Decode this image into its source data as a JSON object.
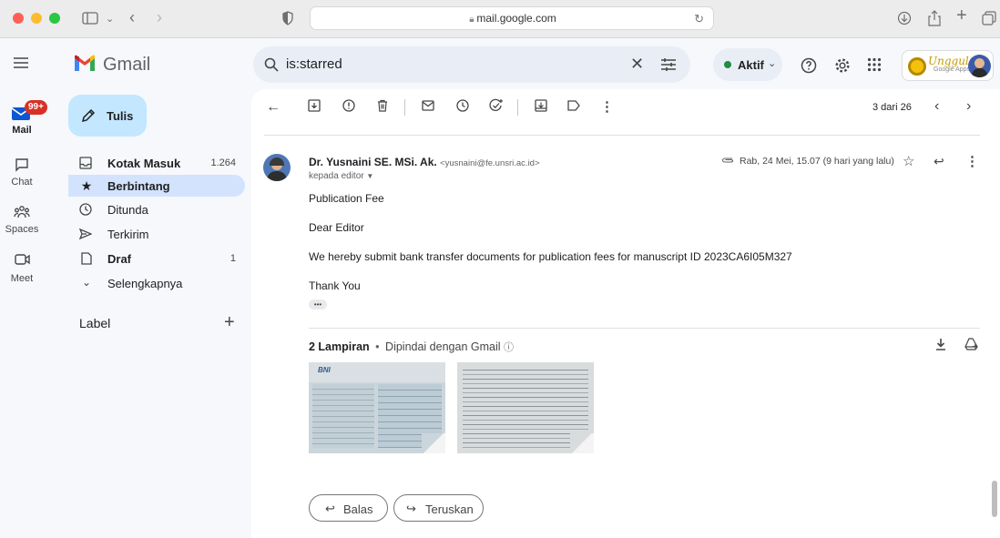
{
  "browser": {
    "url": "mail.google.com"
  },
  "gmail": {
    "logo_text": "Gmail",
    "search_query": "is:starred",
    "status_label": "Aktif",
    "brand_badge_text": "Unggul",
    "brand_badge_sub": "Google Apps"
  },
  "rail": {
    "mail_label": "Mail",
    "mail_badge": "99+",
    "chat_label": "Chat",
    "spaces_label": "Spaces",
    "meet_label": "Meet"
  },
  "nav": {
    "compose_label": "Tulis",
    "items": [
      {
        "label": "Kotak Masuk",
        "count": "1.264",
        "icon": "inbox-icon",
        "bold": true
      },
      {
        "label": "Berbintang",
        "count": "",
        "icon": "star-icon",
        "bold": true
      },
      {
        "label": "Ditunda",
        "count": "",
        "icon": "clock-icon",
        "bold": false
      },
      {
        "label": "Terkirim",
        "count": "",
        "icon": "send-icon",
        "bold": false
      },
      {
        "label": "Draf",
        "count": "1",
        "icon": "draft-icon",
        "bold": true
      },
      {
        "label": "Selengkapnya",
        "count": "",
        "icon": "chevron-down-icon",
        "bold": false
      }
    ],
    "label_heading": "Label"
  },
  "toolbar": {
    "pagination": "3 dari 26"
  },
  "message": {
    "sender_name": "Dr. Yusnaini SE. MSi. Ak.",
    "sender_email": "<yusnaini@fe.unsri.ac.id>",
    "recipient": "kepada editor",
    "date": "Rab, 24 Mei, 15.07 (9 hari yang lalu)",
    "subject_line": "Publication Fee",
    "greeting": "Dear Editor",
    "body": "We hereby submit bank transfer documents for publication fees for manuscript ID 2023CA6I05M327",
    "closing": "Thank You",
    "ellipsis": "•••"
  },
  "attachments": {
    "count_label": "2 Lampiran",
    "scan_label": "Dipindai dengan Gmail",
    "separator": "•"
  },
  "actions": {
    "reply_label": "Balas",
    "forward_label": "Teruskan"
  },
  "colors": {
    "accent_blue": "#c2e7ff",
    "active_nav": "#d3e3fd",
    "status_green": "#1e8e3e",
    "badge_red": "#d93025"
  }
}
